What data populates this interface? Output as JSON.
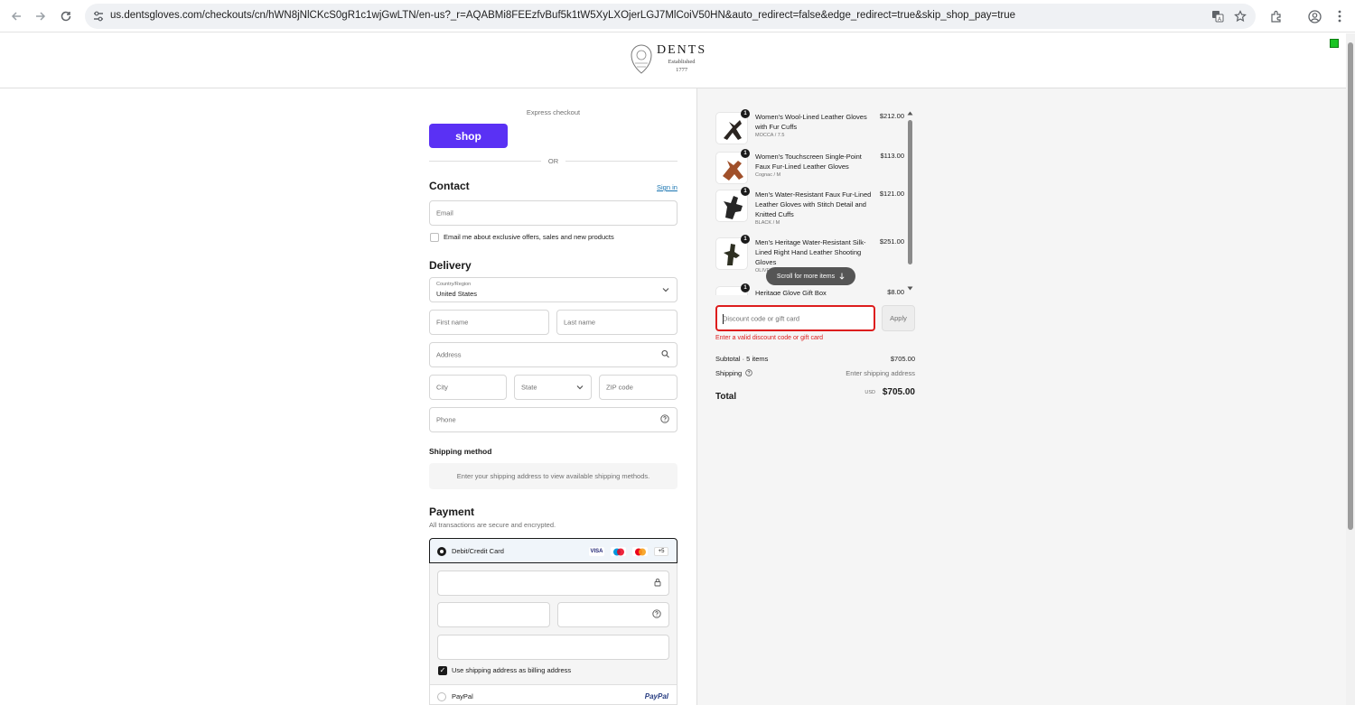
{
  "browser": {
    "url": "us.dentsgloves.com/checkouts/cn/hWN8jNlCKcS0gR1c1wjGwLTN/en-us?_r=AQABMi8FEEzfvBuf5k1tW5XyLXOjerLGJ7MlCoiV50HN&auto_redirect=false&edge_redirect=true&skip_shop_pay=true"
  },
  "header": {
    "brand": "DENTS",
    "established": "Established",
    "year": "1777"
  },
  "express": {
    "label": "Express checkout",
    "shop_button": "shop",
    "or": "OR"
  },
  "contact": {
    "title": "Contact",
    "sign_in": "Sign in",
    "email_placeholder": "Email",
    "marketing_label": "Email me about exclusive offers, sales and new products"
  },
  "delivery": {
    "title": "Delivery",
    "country_label": "Country/Region",
    "country_value": "United States",
    "first_name": "First name",
    "last_name": "Last name",
    "address": "Address",
    "city": "City",
    "state": "State",
    "zip": "ZIP code",
    "phone": "Phone"
  },
  "shipping": {
    "title": "Shipping method",
    "note": "Enter your shipping address to view available shipping methods."
  },
  "payment": {
    "title": "Payment",
    "subtitle": "All transactions are secure and encrypted.",
    "card_option": "Debit/Credit Card",
    "card_logos": [
      "VISA",
      "maestro",
      "mastercard"
    ],
    "more_cards": "+5",
    "billing_same": "Use shipping address as billing address",
    "paypal_option": "PayPal",
    "paypal_logo": "PayPal"
  },
  "summary": {
    "items": [
      {
        "qty": "1",
        "name": "Women's Wool-Lined Leather Gloves with Fur Cuffs",
        "variant": "MOCCA / 7.5",
        "price": "$212.00",
        "color": "#2a2420"
      },
      {
        "qty": "1",
        "name": "Women's Touchscreen Single-Point Faux Fur-Lined Leather Gloves",
        "variant": "Cognac / M",
        "price": "$113.00",
        "color": "#a0502a"
      },
      {
        "qty": "1",
        "name": "Men's Water-Resistant Faux Fur-Lined Leather Gloves with Stitch Detail and Knitted Cuffs",
        "variant": "BLACK / M",
        "price": "$121.00",
        "color": "#262626"
      },
      {
        "qty": "1",
        "name": "Men's Heritage Water-Resistant Silk-Lined Right Hand Leather Shooting Gloves",
        "variant": "OLIVE",
        "price": "$251.00",
        "color": "#2e3022"
      },
      {
        "qty": "1",
        "name": "Heritage Glove Gift Box",
        "variant": "",
        "price": "$8.00",
        "color": "#3a3a3a"
      }
    ],
    "scroll_hint": "Scroll for more items",
    "discount_placeholder": "Discount code or gift card",
    "apply": "Apply",
    "discount_error": "Enter a valid discount code or gift card",
    "subtotal_label": "Subtotal · 5 items",
    "subtotal_value": "$705.00",
    "shipping_label": "Shipping",
    "shipping_value": "Enter shipping address",
    "total_label": "Total",
    "currency": "USD",
    "total_value": "$705.00"
  }
}
